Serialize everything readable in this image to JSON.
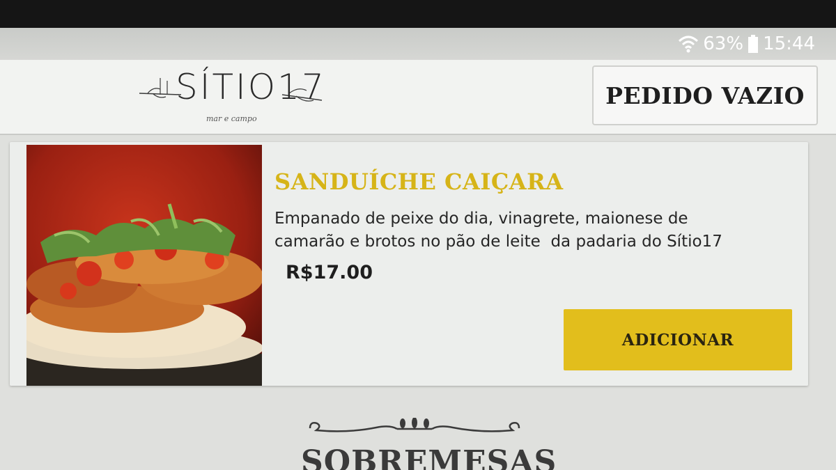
{
  "status_bar": {
    "battery": "63%",
    "time": "15:44",
    "icons": [
      "wifi-icon",
      "battery-icon"
    ]
  },
  "header": {
    "logo": {
      "name": "SÍTIO17",
      "tagline": "mar e campo"
    },
    "order_button": "PEDIDO VAZIO"
  },
  "product": {
    "title": "SANDUÍCHE CAIÇARA",
    "description": "Empanado de peixe do dia, vinagrete, maionese de\ncamarão e brotos no pão de leite  da padaria do Sítio17",
    "price": "R$17.00",
    "add_button": "ADICIONAR"
  },
  "section": {
    "title": "SOBREMESAS"
  },
  "colors": {
    "accent": "#e2be1c",
    "title_yellow": "#d6b418",
    "background": "#eceeec"
  }
}
